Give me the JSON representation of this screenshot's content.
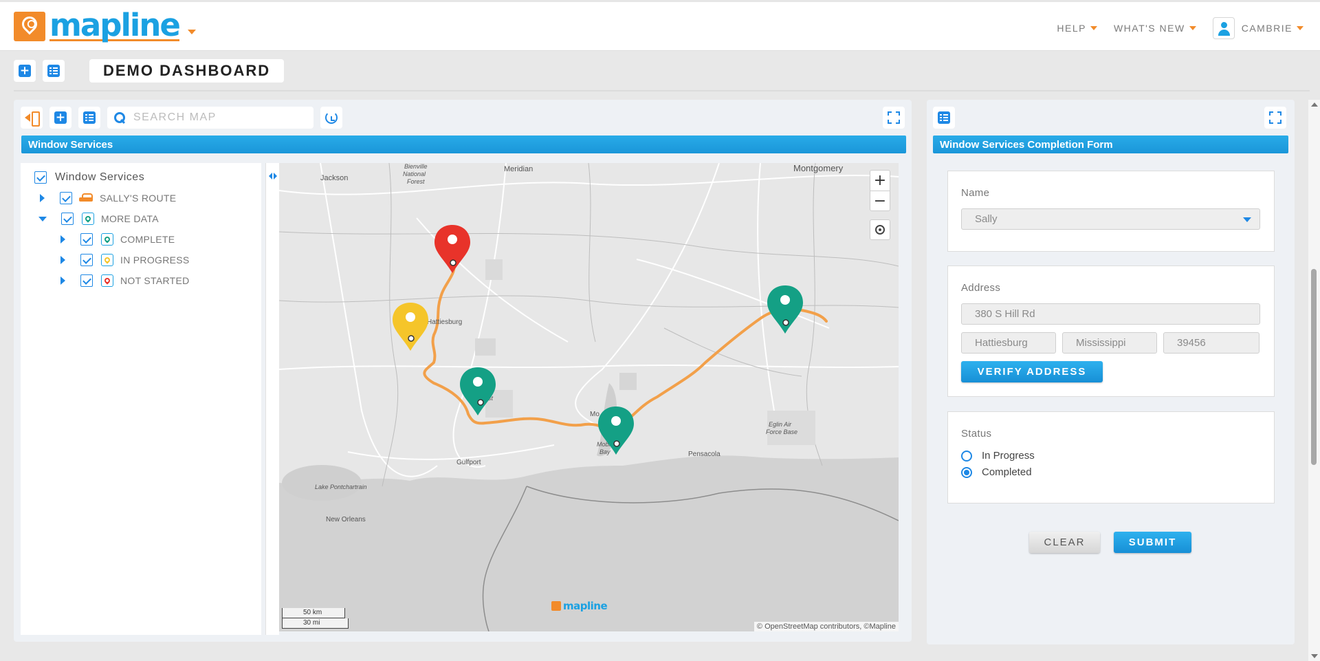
{
  "brand": {
    "name": "mapline",
    "orange": "#f28b2a",
    "blue": "#1ba1e2"
  },
  "topnav": {
    "help": "HELP",
    "whats_new": "WHAT'S NEW",
    "user": "CAMBRIE"
  },
  "dashboard": {
    "title": "DEMO DASHBOARD"
  },
  "map_panel": {
    "search_placeholder": "SEARCH MAP",
    "header": "Window Services",
    "tree": {
      "root": "Window Services",
      "route": "SALLY'S ROUTE",
      "more_data": "MORE DATA",
      "complete": "COMPLETE",
      "in_progress": "IN PROGRESS",
      "not_started": "NOT STARTED"
    },
    "status_colors": {
      "complete": "#14a085",
      "in_progress": "#f5c52a",
      "not_started": "#e8332a",
      "route": "#f2a04a"
    },
    "map": {
      "cities": {
        "jackson": "Jackson",
        "meridian": "Meridian",
        "montgomery": "Montgomery",
        "bienville": "Bienville",
        "national": "National",
        "forest": "Forest",
        "hattiesburg": "Hattiesburg",
        "desoto": "Soto",
        "desoto_forest": "rest",
        "mobile": "Mo",
        "mobile_bay_1": "Mobile",
        "mobile_bay_2": "Bay",
        "pensacola": "Pensacola",
        "eglin_1": "Eglin Air",
        "eglin_2": "Force Base",
        "gulfport": "Gulfport",
        "lake_pontchartrain": "Lake Pontchartrain",
        "new_orleans": "New Orleans"
      },
      "zoom_in": "+",
      "zoom_out": "−",
      "scale_km": "50 km",
      "scale_mi": "30 mi",
      "attribution": "© OpenStreetMap contributors, ©Mapline",
      "logo": "mapline"
    }
  },
  "form_panel": {
    "header": "Window Services Completion Form",
    "name_label": "Name",
    "name_value": "Sally",
    "address_label": "Address",
    "street": "380 S Hill Rd",
    "city": "Hattiesburg",
    "state": "Mississippi",
    "zip": "39456",
    "verify_button": "VERIFY ADDRESS",
    "status_label": "Status",
    "status_options": [
      "In Progress",
      "Completed"
    ],
    "status_selected": "Completed",
    "clear_button": "CLEAR",
    "submit_button": "SUBMIT"
  }
}
